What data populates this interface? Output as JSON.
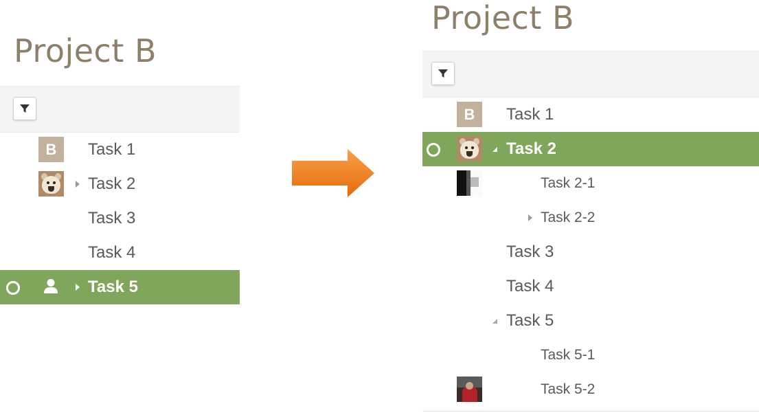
{
  "before": {
    "project_title": "Project B",
    "tasks": [
      {
        "label": "Task 1",
        "avatar": "letter-b-avatar",
        "avatar_letter": "B"
      },
      {
        "label": "Task 2",
        "avatar": "dog-photo-avatar",
        "toggle": "collapsed"
      },
      {
        "label": "Task 3"
      },
      {
        "label": "Task 4"
      },
      {
        "label": "Task 5",
        "avatar": "user-icon",
        "toggle": "collapsed",
        "selected": true
      }
    ]
  },
  "transition": {
    "icon": "arrow-right-icon",
    "color": "#f07f1d"
  },
  "after": {
    "project_title": "Project B",
    "tasks": [
      {
        "label": "Task 1",
        "avatar": "letter-b-avatar",
        "avatar_letter": "B"
      },
      {
        "label": "Task 2",
        "avatar": "dog-photo-avatar",
        "toggle": "expanded",
        "selected": true
      },
      {
        "label": "Task 2-1",
        "avatar": "bw-photo-avatar",
        "level": 1
      },
      {
        "label": "Task 2-2",
        "toggle": "collapsed",
        "level": 1
      },
      {
        "label": "Task 3"
      },
      {
        "label": "Task 4"
      },
      {
        "label": "Task 5",
        "toggle": "expanded"
      },
      {
        "label": "Task 5-1",
        "level": 1
      },
      {
        "label": "Task 5-2",
        "avatar": "red-photo-avatar",
        "level": 1
      }
    ]
  },
  "colors": {
    "selected_row": "#7fa65a",
    "title": "#8e7f6b",
    "toolbar": "#f4f4f4",
    "avatar_letter_bg": "#c2b29c"
  },
  "icons": {
    "filter": "filter-icon",
    "radio": "radio-circle-icon"
  }
}
